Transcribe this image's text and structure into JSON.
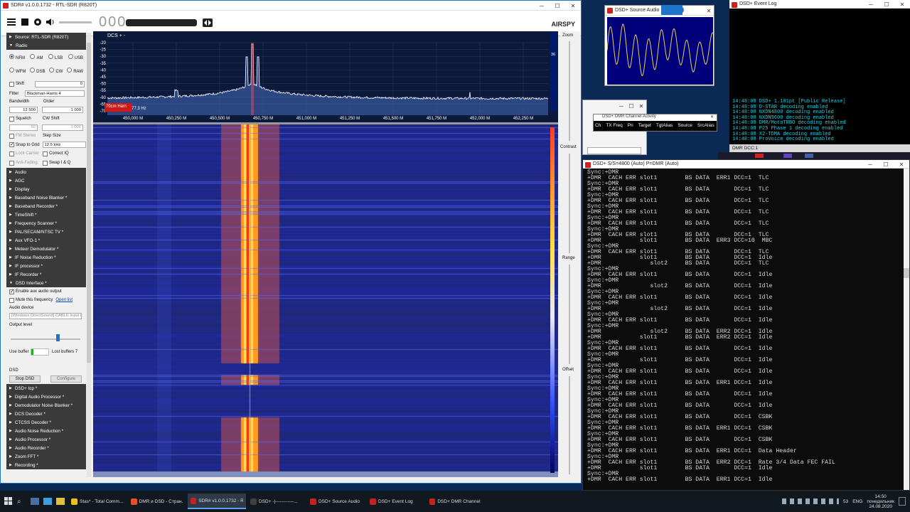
{
  "sdr": {
    "title": "SDR# v1.0.0.1732 - RTL-SDR (R820T)",
    "freq_prefix": "000",
    "brand": "AIRSPY",
    "spectrum_label": "DCS + -",
    "marker_label": "70cm Ham",
    "marker_offset": "77.3 Hz",
    "db_labels": [
      "-20",
      "-25",
      "-30",
      "-35",
      "-40",
      "-45",
      "-50",
      "-55",
      "-60",
      "-65",
      "-70"
    ],
    "freq_labels": [
      "450,000 M",
      "450,250 M",
      "450,500 M",
      "450,750 M",
      "451,000 M",
      "451,250 M",
      "451,500 M",
      "451,750 M",
      "452,000 M",
      "452,250 M"
    ],
    "right_labels": {
      "zoom": "Zoom",
      "contrast": "Contrast",
      "range": "Range",
      "offset": "Offset",
      "val": "36"
    },
    "sidebar": {
      "source": "Source: RTL-SDR (R820T)",
      "radio": "Radio",
      "modes_row1": [
        "NFM",
        "AM",
        "LSB",
        "USB"
      ],
      "modes_row2": [
        "WFM",
        "DSB",
        "CW",
        "RAW"
      ],
      "shift_label": "Shift",
      "shift_value": "0",
      "filter_label": "Filter",
      "filter_value": "Blackman-Harris 4",
      "bandwidth_label": "Bandwidth",
      "order_label": "Order",
      "bandwidth_value": "12 500",
      "order_value": "1 000",
      "squelch_label": "Squelch",
      "cw_shift_label": "CW Shift",
      "squelch_value": "60",
      "cw_shift_value": "1 000",
      "fm_stereo": "FM Stereo",
      "step_size": "Step Size",
      "snap_label": "Snap to Grid",
      "snap_value": "12.5 kHz",
      "lock_carrier": "Lock Carrier",
      "correct_iq": "Correct IQ",
      "anti_fading": "Anti-Fading",
      "swap_iq": "Swap I & Q",
      "sections_a": [
        "Audio",
        "AGC",
        "Display",
        "Baseband Noise Blanker *",
        "Baseband Recorder *",
        "TimeShift *",
        "Frequency Scanner *",
        "PAL/SECAM/NTSC TV *",
        "Aux VFO-1 *",
        "Meteor Demodulator *",
        "IF Noise Reduction *",
        "IF processor *",
        "IF Recorder *"
      ],
      "dsd_interface": "DSD Interface *",
      "enable_aux": "Enable aux audio output",
      "mute_freq": "Mute this frequency",
      "open_list": "Open list",
      "audio_device": "Audio device",
      "audio_device_value": "[Windows DirectSound] CABLE Input (",
      "output_level": "Output level",
      "use_buffer": "Use buffer",
      "lost_buffers": "Lost buffers 7",
      "dsd": "DSD",
      "stop_dsd": "Stop DSD",
      "configure": "Configure",
      "sections_b": [
        "DSD+ tcp *",
        "Digital Audio Processor *",
        "Demodulator Noise Blanker *",
        "DCS Decoder *",
        "CTCSS Decoder *",
        "Audio Noise Reduction *",
        "Audio Processor *",
        "Audio Recorder *",
        "Zoom FFT *",
        "Recording *"
      ]
    }
  },
  "source_audio": {
    "title": "DSD+ Source Audio"
  },
  "channel_activity": {
    "title": "DSD+ DMR Channel Activity",
    "columns": [
      "Ch",
      "TX Freq",
      "Pri",
      "Target",
      "TgtAlias",
      "Source",
      "SrcAlias"
    ]
  },
  "event_log": {
    "title": "DSD+ Event Log",
    "lines": [
      "14:48:08 DSD+ 1.101pt [Public Release]",
      "14:48:08 D-STAR decoding enabled",
      "14:48:08 NXDN4800 decoding enabled",
      "14:48:08 NXDN9600 decoding enabled",
      "14:48:08 DMR/MotoTRBO decoding enabled",
      "14:48:08 P25 Phase 1 decoding enabled",
      "14:48:08 X2-TDMA decoding enabled",
      "14:48:08 ProVoice decoding enabled"
    ],
    "status": "DMR  DCC:1"
  },
  "console": {
    "title": "DSD+  S/S=4800 (Auto) P=DMR (Auto)",
    "lines": [
      "Sync:+DMR",
      "+DMR  CACH ERR slot1        BS DATA  ERR1 DCC=1  TLC",
      "Sync:+DMR",
      "+DMR  CACH ERR slot1        BS DATA       DCC=1  TLC",
      "Sync:+DMR",
      "+DMR  CACH ERR slot1        BS DATA       DCC=1  TLC",
      "Sync:+DMR",
      "+DMR  CACH ERR slot1        BS DATA       DCC=1  TLC",
      "Sync:+DMR",
      "+DMR  CACH ERR slot1        BS DATA       DCC=1  TLC",
      "Sync:+DMR",
      "+DMR  CACH ERR slot1        BS DATA       DCC=1  TLC",
      "+DMR           slot1        BS DATA  ERR3 DCC=10  MBC",
      "Sync:+DMR",
      "+DMR  CACH ERR slot1        BS DATA       DCC=1  TLC",
      "+DMR           slot1        BS DATA       DCC=1  Idle",
      "+DMR              slot2     BS DATA       DCC=1  TLC",
      "Sync:+DMR",
      "+DMR  CACH ERR slot1        BS DATA       DCC=1  Idle",
      "Sync:+DMR",
      "+DMR              slot2     BS DATA       DCC=1  Idle",
      "Sync:+DMR",
      "+DMR  CACH ERR slot1        BS DATA       DCC=1  Idle",
      "Sync:+DMR",
      "+DMR              slot2     BS DATA       DCC=1  Idle",
      "Sync:+DMR",
      "+DMR  CACH ERR slot1        BS DATA       DCC=1  Idle",
      "Sync:+DMR",
      "+DMR              slot2     BS DATA  ERR2 DCC=1  Idle",
      "+DMR           slot1        BS DATA  ERR2 DCC=1  Idle",
      "Sync:+DMR",
      "+DMR  CACH ERR slot1        BS DATA       DCC=1  Idle",
      "Sync:+DMR",
      "+DMR           slot1        BS DATA       DCC=1  Idle",
      "Sync:+DMR",
      "+DMR  CACH ERR slot1        BS DATA       DCC=1  Idle",
      "Sync:+DMR",
      "+DMR  CACH ERR slot1        BS DATA  ERR1 DCC=1  Idle",
      "Sync:+DMR",
      "+DMR  CACH ERR slot1        BS DATA       DCC=1  Idle",
      "Sync:+DMR",
      "+DMR  CACH ERR slot1        BS DATA       DCC=1  Idle",
      "Sync:+DMR",
      "+DMR  CACH ERR slot1        BS DATA       DCC=1  CSBK",
      "Sync:+DMR",
      "+DMR  CACH ERR slot1        BS DATA  ERR1 DCC=1  CSBK",
      "Sync:+DMR",
      "+DMR  CACH ERR slot1        BS DATA       DCC=1  CSBK",
      "Sync:+DMR",
      "+DMR  CACH ERR slot1        BS DATA  ERR1 DCC=1  Data Header",
      "Sync:+DMR",
      "+DMR  CACH ERR slot1        BS DATA  ERR2 DCC=1  Rate 3/4 Data FEC FAIL",
      "+DMR           slot1        BS DATA       DCC=1  Idle",
      "Sync:+DMR",
      "+DMR  CACH ERR slot1        BS DATA  ERR1 DCC=1  Idle"
    ]
  },
  "taskbar": {
    "items": [
      {
        "label": "Stas* - Total Comm...",
        "color": "#f0c020"
      },
      {
        "label": "DMR и DSD - Стран...",
        "color": "#e8502a"
      },
      {
        "label": "SDR# v1.0.0.1732 - R...",
        "color": "#c22222",
        "active": true
      },
      {
        "label": "DSD+  -|------------...",
        "color": "#404040"
      },
      {
        "label": "DSD+ Source Audio",
        "color": "#c22222"
      },
      {
        "label": "DSD+ Event Log",
        "color": "#c22222"
      },
      {
        "label": "DSD+ DMR Channel ...",
        "color": "#c22222"
      }
    ],
    "lang": "ENG",
    "badge": "53",
    "time": "14:50",
    "day": "понедельник",
    "date": "24.08.2020"
  }
}
